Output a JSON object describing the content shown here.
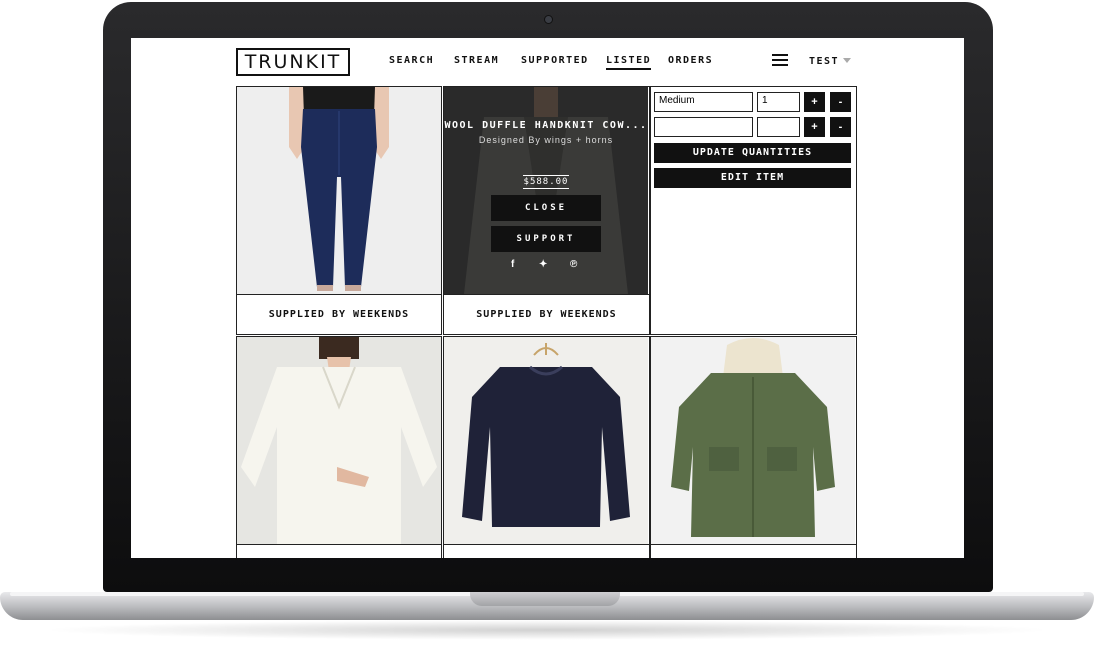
{
  "header": {
    "logo": "TRUNKIT",
    "nav": [
      "SEARCH",
      "STREAM",
      "SUPPORTED",
      "LISTED",
      "ORDERS"
    ],
    "active_nav": "LISTED",
    "user": "TEST"
  },
  "products": {
    "jeans": {
      "caption": "SUPPLIED BY WEEKENDS"
    },
    "jacket": {
      "title": "WOOL DUFFLE HANDKNIT COW...",
      "designer": "Designed By wings + horns",
      "price": "$588.00",
      "close_label": "CLOSE",
      "support_label": "SUPPORT",
      "caption": "SUPPLIED BY WEEKENDS",
      "social_icons": [
        "facebook-icon",
        "twitter-icon",
        "pinterest-icon"
      ]
    }
  },
  "quantity_editor": {
    "rows": [
      {
        "size": "Medium",
        "qty": "1"
      },
      {
        "size": "",
        "qty": ""
      }
    ],
    "plus": "+",
    "minus": "-",
    "update_label": "UPDATE QUANTITIES",
    "edit_label": "EDIT ITEM"
  },
  "colors": {
    "accent": "#111111",
    "overlay": "#2a2a2a",
    "parka": "#5b6e48",
    "sweater": "#1f2238",
    "jeans": "#1d2c5a"
  }
}
